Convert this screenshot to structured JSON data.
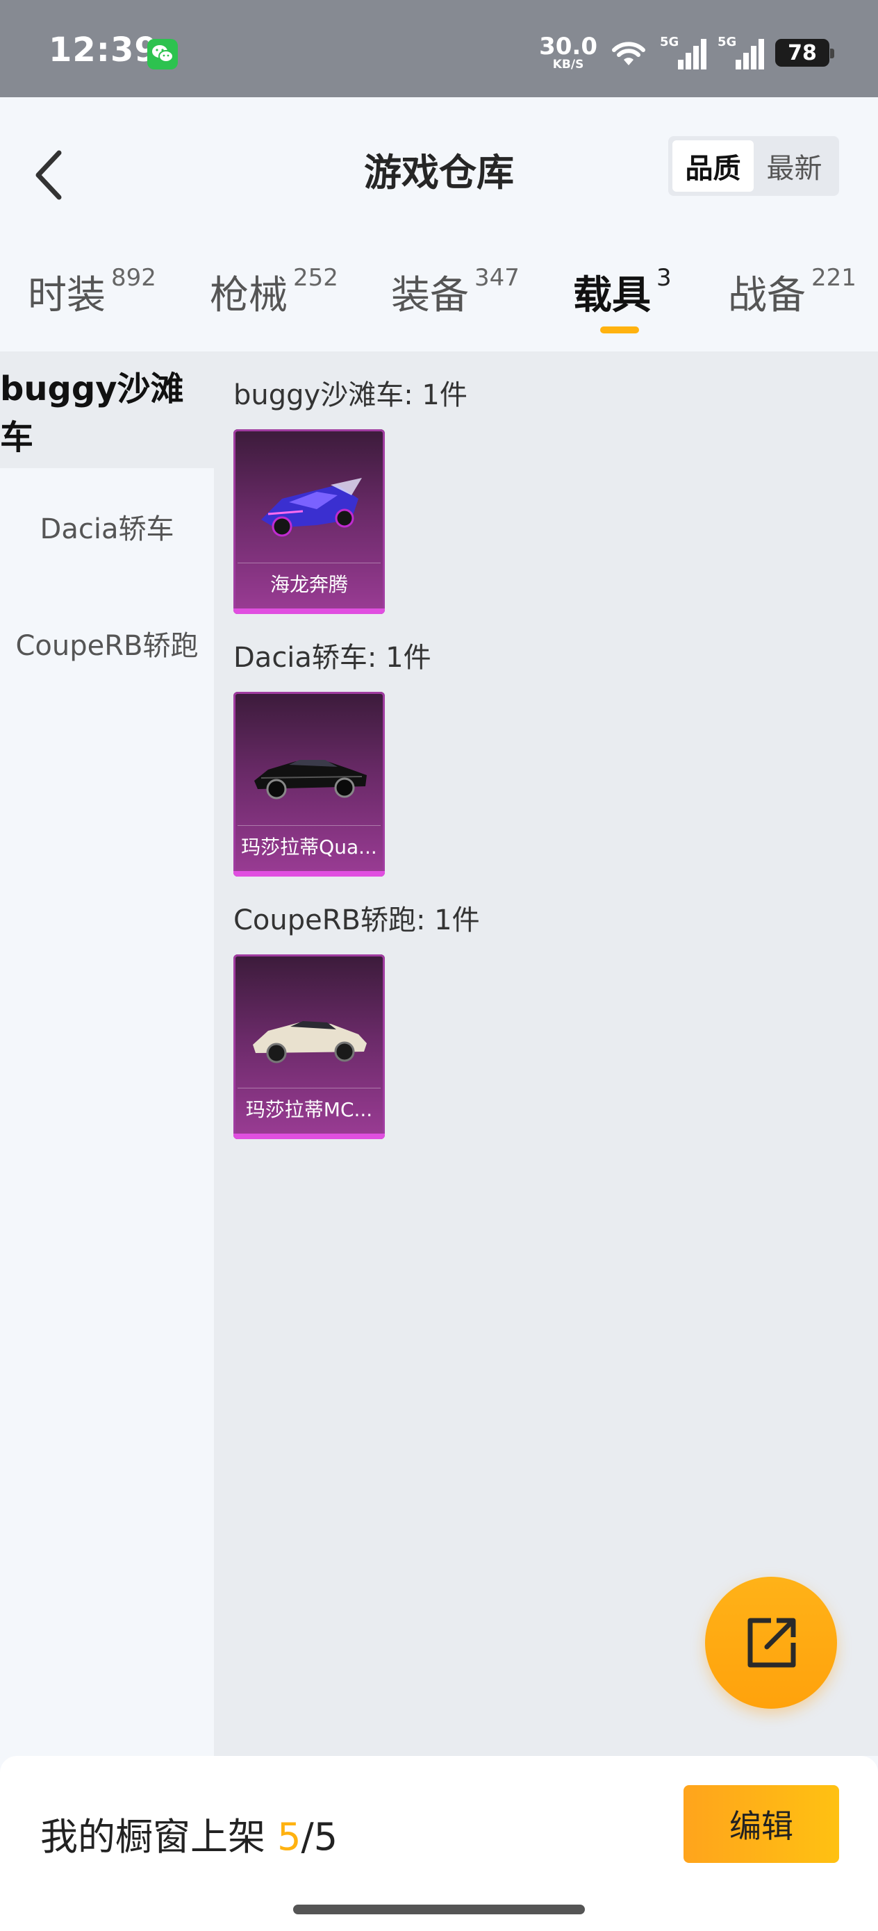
{
  "status_bar": {
    "time": "12:39",
    "net_speed": "30.0",
    "net_unit": "KB/S",
    "signal_1": "5G",
    "signal_2": "5G",
    "battery": "78"
  },
  "header": {
    "title": "游戏仓库",
    "sort_options": [
      "品质",
      "最新"
    ],
    "sort_selected": "品质"
  },
  "tabs": [
    {
      "label": "时装",
      "count": "892"
    },
    {
      "label": "枪械",
      "count": "252"
    },
    {
      "label": "装备",
      "count": "347"
    },
    {
      "label": "载具",
      "count": "3",
      "active": true
    },
    {
      "label": "战备",
      "count": "221"
    }
  ],
  "sidebar": {
    "items": [
      {
        "label": "buggy沙滩车",
        "active": true
      },
      {
        "label": "Dacia轿车"
      },
      {
        "label": "CoupeRB轿跑"
      }
    ]
  },
  "groups": [
    {
      "title": "buggy沙滩车: 1件",
      "items": [
        {
          "name": "海龙奔腾"
        }
      ]
    },
    {
      "title": "Dacia轿车: 1件",
      "items": [
        {
          "name": "玛莎拉蒂Qua..."
        }
      ]
    },
    {
      "title": "CoupeRB轿跑: 1件",
      "items": [
        {
          "name": "玛莎拉蒂MC..."
        }
      ]
    }
  ],
  "bottom": {
    "showcase_prefix": "我的橱窗上架 ",
    "showcase_current": "5",
    "showcase_total": "/5",
    "edit_label": "编辑"
  },
  "colors": {
    "accent": "#ffb20f",
    "card_purple": "#9b3c95",
    "status_bar_bg": "#868a92"
  },
  "icons": {
    "back": "chevron-left-icon",
    "share": "share-external-icon",
    "wechat": "wechat-icon",
    "wifi": "wifi-icon"
  }
}
